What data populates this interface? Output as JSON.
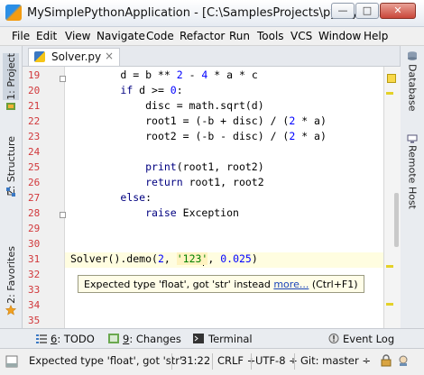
{
  "window": {
    "title": "MySimplePythonApplication - [C:\\SamplesProjects\\py\\MySi...",
    "min_label": "—",
    "max_label": "□",
    "close_label": "✕"
  },
  "menu": [
    "File",
    "Edit",
    "View",
    "Navigate",
    "Code",
    "Refactor",
    "Run",
    "Tools",
    "VCS",
    "Window",
    "Help"
  ],
  "left_tools": [
    {
      "label": "1: Project",
      "icon": "project-icon"
    },
    {
      "label": "Z: Structure",
      "icon": "structure-icon"
    },
    {
      "label": "2: Favorites",
      "icon": "favorites-star-icon"
    }
  ],
  "right_tools": [
    {
      "label": "Database",
      "icon": "database-icon"
    },
    {
      "label": "Remote Host",
      "icon": "remote-host-icon"
    }
  ],
  "editor": {
    "file_tab": "Solver.py",
    "close_glyph": "×",
    "lines": [
      {
        "n": "19",
        "indent": 8,
        "tokens": [
          {
            "t": "d = b ** "
          },
          {
            "t": "2",
            "c": "num"
          },
          {
            "t": " - "
          },
          {
            "t": "4",
            "c": "num"
          },
          {
            "t": " * a * c"
          }
        ]
      },
      {
        "n": "20",
        "indent": 8,
        "tokens": [
          {
            "t": "if",
            "c": "kw"
          },
          {
            "t": " d >= "
          },
          {
            "t": "0",
            "c": "num"
          },
          {
            "t": ":"
          }
        ]
      },
      {
        "n": "21",
        "indent": 12,
        "tokens": [
          {
            "t": "disc = math.sqrt(d)"
          }
        ]
      },
      {
        "n": "22",
        "indent": 12,
        "tokens": [
          {
            "t": "root1 = (-b + disc) / ("
          },
          {
            "t": "2",
            "c": "num"
          },
          {
            "t": " * a)"
          }
        ]
      },
      {
        "n": "23",
        "indent": 12,
        "tokens": [
          {
            "t": "root2 = (-b - disc) / ("
          },
          {
            "t": "2",
            "c": "num"
          },
          {
            "t": " * a)"
          }
        ]
      },
      {
        "n": "24",
        "indent": 0,
        "tokens": []
      },
      {
        "n": "25",
        "indent": 12,
        "tokens": [
          {
            "t": "print",
            "c": "kw"
          },
          {
            "t": "(root1, root2)"
          }
        ]
      },
      {
        "n": "26",
        "indent": 12,
        "tokens": [
          {
            "t": "return",
            "c": "kw"
          },
          {
            "t": " root1, root2"
          }
        ]
      },
      {
        "n": "27",
        "indent": 8,
        "tokens": [
          {
            "t": "else",
            "c": "kw"
          },
          {
            "t": ":"
          }
        ]
      },
      {
        "n": "28",
        "indent": 12,
        "tokens": [
          {
            "t": "raise",
            "c": "kw"
          },
          {
            "t": " Exception"
          }
        ]
      },
      {
        "n": "29",
        "indent": 0,
        "tokens": []
      },
      {
        "n": "30",
        "indent": 0,
        "tokens": []
      },
      {
        "n": "31",
        "indent": 0,
        "tokens": [
          {
            "t": "Solver().demo("
          },
          {
            "t": "2",
            "c": "num"
          },
          {
            "t": ", "
          },
          {
            "t": "'123'",
            "c": "str"
          },
          {
            "t": ", "
          },
          {
            "t": "0.025",
            "c": "num"
          },
          {
            "t": ")"
          }
        ]
      },
      {
        "n": "32",
        "indent": 0,
        "tokens": []
      },
      {
        "n": "33",
        "indent": 0,
        "tokens": []
      },
      {
        "n": "34",
        "indent": 0,
        "tokens": []
      },
      {
        "n": "35",
        "indent": 0,
        "tokens": []
      }
    ],
    "tooltip": {
      "message": "Expected type 'float', got 'str' instead ",
      "link": "more...",
      "shortcut": " (Ctrl+F1)"
    }
  },
  "bottom_tools": [
    {
      "mnemonic": "6",
      "label": ": TODO",
      "icon": "todo-icon"
    },
    {
      "mnemonic": "9",
      "label": ": Changes",
      "icon": "changes-icon"
    },
    {
      "mnemonic": "",
      "label": "Terminal",
      "icon": "terminal-icon"
    },
    {
      "mnemonic": "",
      "label": "Event Log",
      "icon": "event-log-icon"
    }
  ],
  "status": {
    "message": "Expected type 'float', got 'str'",
    "position": "31:22",
    "line_separator": "CRLF ÷",
    "encoding": "UTF-8 ÷",
    "vcs": "Git: master ÷"
  },
  "colors": {
    "line_number": "#d1383b",
    "keyword": "#000080",
    "string": "#008000",
    "number": "#0000ff",
    "current_line": "#fffde0",
    "tooltip_bg": "#fffde8",
    "warning_mark": "#f8d84a"
  }
}
